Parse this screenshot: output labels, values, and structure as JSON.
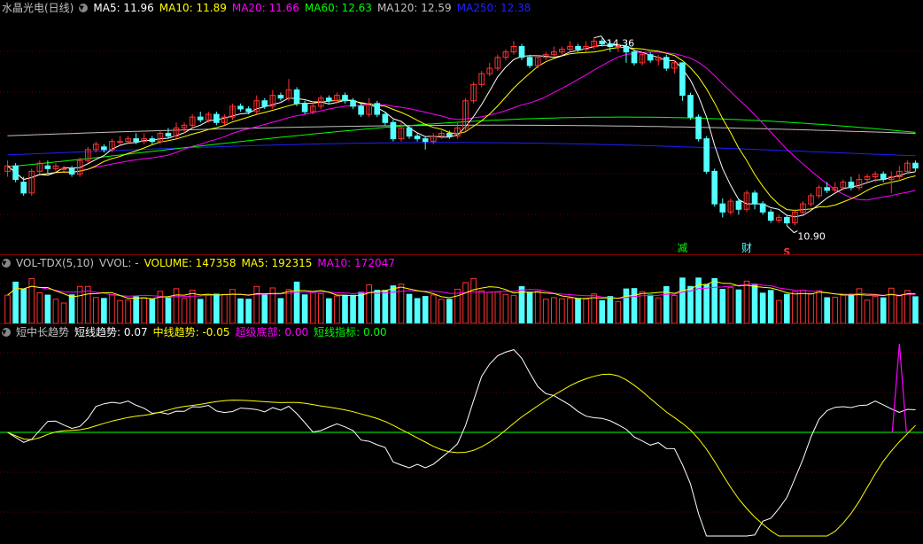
{
  "colors": {
    "background": "#000000",
    "up": "#ff3232",
    "down": "#54ffff",
    "ma5": "#ffffff",
    "ma10": "#ffff00",
    "ma20": "#ff00ff",
    "ma60": "#00ff00",
    "ma120": "#c0c0c0",
    "ma250": "#2020ff",
    "grid": "#600000"
  },
  "main_panel": {
    "title": "水晶光电(日线)",
    "ma5_label": "MA5: 11.96",
    "ma10_label": "MA10: 11.89",
    "ma20_label": "MA20: 11.66",
    "ma60_label": "MA60: 12.63",
    "ma120_label": "MA120: 12.59",
    "ma250_label": "MA250: 12.38",
    "high_label": "14.36",
    "low_label": "10.90",
    "marker_reduce": "减",
    "marker_finance": "财",
    "marker_s": "S"
  },
  "volume_panel": {
    "title": "VOL-TDX(5,10)",
    "vvol_label": "VVOL: -",
    "volume_label": "VOLUME: 147358",
    "ma5_label": "MA5: 192315",
    "ma10_label": "MA10: 172047"
  },
  "trend_panel": {
    "title": "短中长趋势",
    "short_label": "短线趋势: 0.07",
    "mid_label": "中线趋势: -0.05",
    "bottom_label": "超级底部: 0.00",
    "indicator_label": "短线指标: 0.00"
  },
  "chart_data": {
    "type": "candlestick",
    "price_range": [
      10.6,
      14.6
    ],
    "candles": [
      [
        11.9,
        12.0,
        12.1,
        11.8
      ],
      [
        12.0,
        11.75,
        12.05,
        11.7
      ],
      [
        11.7,
        11.5,
        11.8,
        11.45
      ],
      [
        11.5,
        11.9,
        11.95,
        11.45
      ],
      [
        11.9,
        12.05,
        12.1,
        11.85
      ],
      [
        12.0,
        11.95,
        12.1,
        11.85
      ],
      [
        11.95,
        12.0,
        12.05,
        11.9
      ],
      [
        11.95,
        11.95,
        12.0,
        11.9
      ],
      [
        11.95,
        11.85,
        12.0,
        11.8
      ],
      [
        11.85,
        12.1,
        12.15,
        11.8
      ],
      [
        12.1,
        12.3,
        12.35,
        12.05
      ],
      [
        12.3,
        12.4,
        12.45,
        12.25
      ],
      [
        12.35,
        12.3,
        12.4,
        12.25
      ],
      [
        12.3,
        12.45,
        12.5,
        12.25
      ],
      [
        12.45,
        12.45,
        12.55,
        12.4
      ],
      [
        12.45,
        12.5,
        12.55,
        12.4
      ],
      [
        12.5,
        12.45,
        12.6,
        12.4
      ],
      [
        12.45,
        12.5,
        12.6,
        12.4
      ],
      [
        12.5,
        12.45,
        12.55,
        12.4
      ],
      [
        12.45,
        12.6,
        12.65,
        12.4
      ],
      [
        12.6,
        12.55,
        12.7,
        12.5
      ],
      [
        12.55,
        12.7,
        12.8,
        12.5
      ],
      [
        12.7,
        12.75,
        12.8,
        12.6
      ],
      [
        12.75,
        12.9,
        12.95,
        12.7
      ],
      [
        12.9,
        12.85,
        13.0,
        12.8
      ],
      [
        12.85,
        12.95,
        13.0,
        12.8
      ],
      [
        12.95,
        12.8,
        13.0,
        12.75
      ],
      [
        12.8,
        12.9,
        12.95,
        12.75
      ],
      [
        12.9,
        13.1,
        13.15,
        12.85
      ],
      [
        13.1,
        13.05,
        13.15,
        13.0
      ],
      [
        13.05,
        13.0,
        13.1,
        12.95
      ],
      [
        13.0,
        13.2,
        13.3,
        12.95
      ],
      [
        13.2,
        13.1,
        13.25,
        13.05
      ],
      [
        13.1,
        13.3,
        13.4,
        13.05
      ],
      [
        13.3,
        13.25,
        13.35,
        13.2
      ],
      [
        13.25,
        13.4,
        13.6,
        13.2
      ],
      [
        13.4,
        13.15,
        13.45,
        13.1
      ],
      [
        13.15,
        13.0,
        13.2,
        12.95
      ],
      [
        13.0,
        13.1,
        13.2,
        12.95
      ],
      [
        13.1,
        13.25,
        13.3,
        13.05
      ],
      [
        13.25,
        13.2,
        13.3,
        13.15
      ],
      [
        13.2,
        13.3,
        13.35,
        13.15
      ],
      [
        13.3,
        13.2,
        13.35,
        13.15
      ],
      [
        13.2,
        13.1,
        13.25,
        13.05
      ],
      [
        13.1,
        12.95,
        13.15,
        12.9
      ],
      [
        12.95,
        13.15,
        13.25,
        12.9
      ],
      [
        13.15,
        12.95,
        13.2,
        12.9
      ],
      [
        12.95,
        12.8,
        13.0,
        12.75
      ],
      [
        12.8,
        12.5,
        12.85,
        12.45
      ],
      [
        12.5,
        12.7,
        12.8,
        12.45
      ],
      [
        12.7,
        12.55,
        12.75,
        12.5
      ],
      [
        12.55,
        12.5,
        12.6,
        12.45
      ],
      [
        12.5,
        12.45,
        12.55,
        12.3
      ],
      [
        12.45,
        12.55,
        12.6,
        12.4
      ],
      [
        12.55,
        12.6,
        12.65,
        12.5
      ],
      [
        12.6,
        12.55,
        12.65,
        12.5
      ],
      [
        12.55,
        12.7,
        12.8,
        12.5
      ],
      [
        12.7,
        13.2,
        13.25,
        12.65
      ],
      [
        13.2,
        13.5,
        13.55,
        13.15
      ],
      [
        13.5,
        13.7,
        13.75,
        13.45
      ],
      [
        13.7,
        13.8,
        13.9,
        13.65
      ],
      [
        13.8,
        14.0,
        14.05,
        13.75
      ],
      [
        14.0,
        14.1,
        14.15,
        13.95
      ],
      [
        14.1,
        14.2,
        14.3,
        14.05
      ],
      [
        14.2,
        14.0,
        14.25,
        13.95
      ],
      [
        14.0,
        13.85,
        14.05,
        13.8
      ],
      [
        13.85,
        14.0,
        14.05,
        13.8
      ],
      [
        14.0,
        14.05,
        14.1,
        13.95
      ],
      [
        14.05,
        14.1,
        14.2,
        14.0
      ],
      [
        14.1,
        14.15,
        14.2,
        14.05
      ],
      [
        14.15,
        14.2,
        14.3,
        14.1
      ],
      [
        14.2,
        14.15,
        14.25,
        14.1
      ],
      [
        14.15,
        14.2,
        14.3,
        14.1
      ],
      [
        14.2,
        14.3,
        14.36,
        14.15
      ],
      [
        14.3,
        14.25,
        14.35,
        14.2
      ],
      [
        14.25,
        14.2,
        14.3,
        14.1
      ],
      [
        14.2,
        14.2,
        14.25,
        14.1
      ],
      [
        14.2,
        14.1,
        14.25,
        13.9
      ],
      [
        14.1,
        13.9,
        14.15,
        13.85
      ],
      [
        13.9,
        14.05,
        14.1,
        13.85
      ],
      [
        14.05,
        13.95,
        14.1,
        13.9
      ],
      [
        13.95,
        14.0,
        14.05,
        13.85
      ],
      [
        14.0,
        13.8,
        14.05,
        13.75
      ],
      [
        13.8,
        13.9,
        13.95,
        13.7
      ],
      [
        13.9,
        13.3,
        13.9,
        13.2
      ],
      [
        13.3,
        12.9,
        13.35,
        12.85
      ],
      [
        12.9,
        12.5,
        12.95,
        12.45
      ],
      [
        12.5,
        11.9,
        12.55,
        11.85
      ],
      [
        11.9,
        11.3,
        11.95,
        11.25
      ],
      [
        11.3,
        11.15,
        11.4,
        11.05
      ],
      [
        11.15,
        11.35,
        11.4,
        11.1
      ],
      [
        11.35,
        11.2,
        11.4,
        11.1
      ],
      [
        11.2,
        11.5,
        11.55,
        11.15
      ],
      [
        11.5,
        11.3,
        11.55,
        11.2
      ],
      [
        11.3,
        11.15,
        11.35,
        11.1
      ],
      [
        11.15,
        11.0,
        11.2,
        10.95
      ],
      [
        11.0,
        11.05,
        11.1,
        10.95
      ],
      [
        11.05,
        10.95,
        11.1,
        10.9
      ],
      [
        10.95,
        11.15,
        11.2,
        10.9
      ],
      [
        11.15,
        11.3,
        11.35,
        11.1
      ],
      [
        11.3,
        11.45,
        11.5,
        11.25
      ],
      [
        11.45,
        11.6,
        11.65,
        11.4
      ],
      [
        11.6,
        11.55,
        11.7,
        11.5
      ],
      [
        11.55,
        11.6,
        11.7,
        11.5
      ],
      [
        11.6,
        11.7,
        11.75,
        11.55
      ],
      [
        11.7,
        11.6,
        11.8,
        11.55
      ],
      [
        11.6,
        11.75,
        11.85,
        11.55
      ],
      [
        11.75,
        11.8,
        11.85,
        11.7
      ],
      [
        11.8,
        11.85,
        11.9,
        11.7
      ],
      [
        11.85,
        11.75,
        11.9,
        11.7
      ],
      [
        11.75,
        11.8,
        11.9,
        11.5
      ],
      [
        11.8,
        11.9,
        12.0,
        11.75
      ],
      [
        11.9,
        12.05,
        12.1,
        11.85
      ],
      [
        12.05,
        11.96,
        12.1,
        11.9
      ]
    ]
  }
}
